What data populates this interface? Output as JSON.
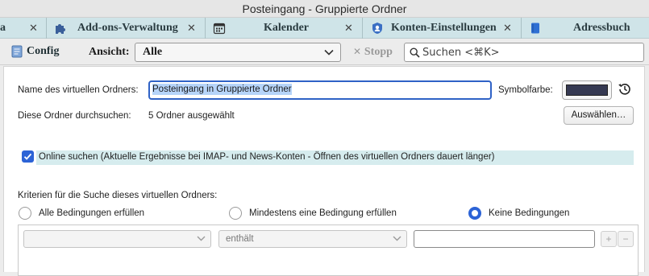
{
  "window": {
    "title": "Posteingang - Gruppierte Ordner"
  },
  "tabs": [
    {
      "label": "a",
      "icon": "mail-icon"
    },
    {
      "label": "Add-ons-Verwaltung",
      "icon": "puzzle-icon"
    },
    {
      "label": "Kalender",
      "icon": "calendar-icon"
    },
    {
      "label": "Konten-Einstellungen",
      "icon": "account-settings-icon"
    },
    {
      "label": "Adressbuch",
      "icon": "address-book-icon"
    }
  ],
  "toolbar": {
    "config_label": "Config",
    "ansicht_label": "Ansicht:",
    "ansicht_value": "Alle",
    "stopp_label": "Stopp",
    "search_placeholder": "Suchen <⌘K>"
  },
  "form": {
    "name_label": "Name des virtuellen Ordners:",
    "name_value": "Posteingang in Gruppierte Ordner",
    "symbol_label": "Symbolfarbe:",
    "symbol_color": "#353952",
    "folders_label": "Diese Ordner durchsuchen:",
    "folders_value": "5 Ordner ausgewählt",
    "choose_button": "Auswählen…",
    "online_label": "Online suchen (Aktuelle Ergebnisse bei IMAP- und News-Konten - Öffnen des virtuellen Ordners dauert länger)",
    "online_checked": true,
    "criteria_label": "Kriterien für die Suche dieses virtuellen Ordners:",
    "radios": [
      {
        "label": "Alle Bedingungen erfüllen",
        "selected": false
      },
      {
        "label": "Mindestens eine Bedingung erfüllen",
        "selected": false
      },
      {
        "label": "Keine Bedingungen",
        "selected": true
      }
    ],
    "rule": {
      "field_value": "",
      "operator_value": "enthält",
      "text_value": "",
      "add_label": "+",
      "remove_label": "−"
    }
  },
  "colors": {
    "accent": "#2c63d6",
    "tabbar": "#cfe4e8",
    "selection": "#b6d4f9"
  }
}
